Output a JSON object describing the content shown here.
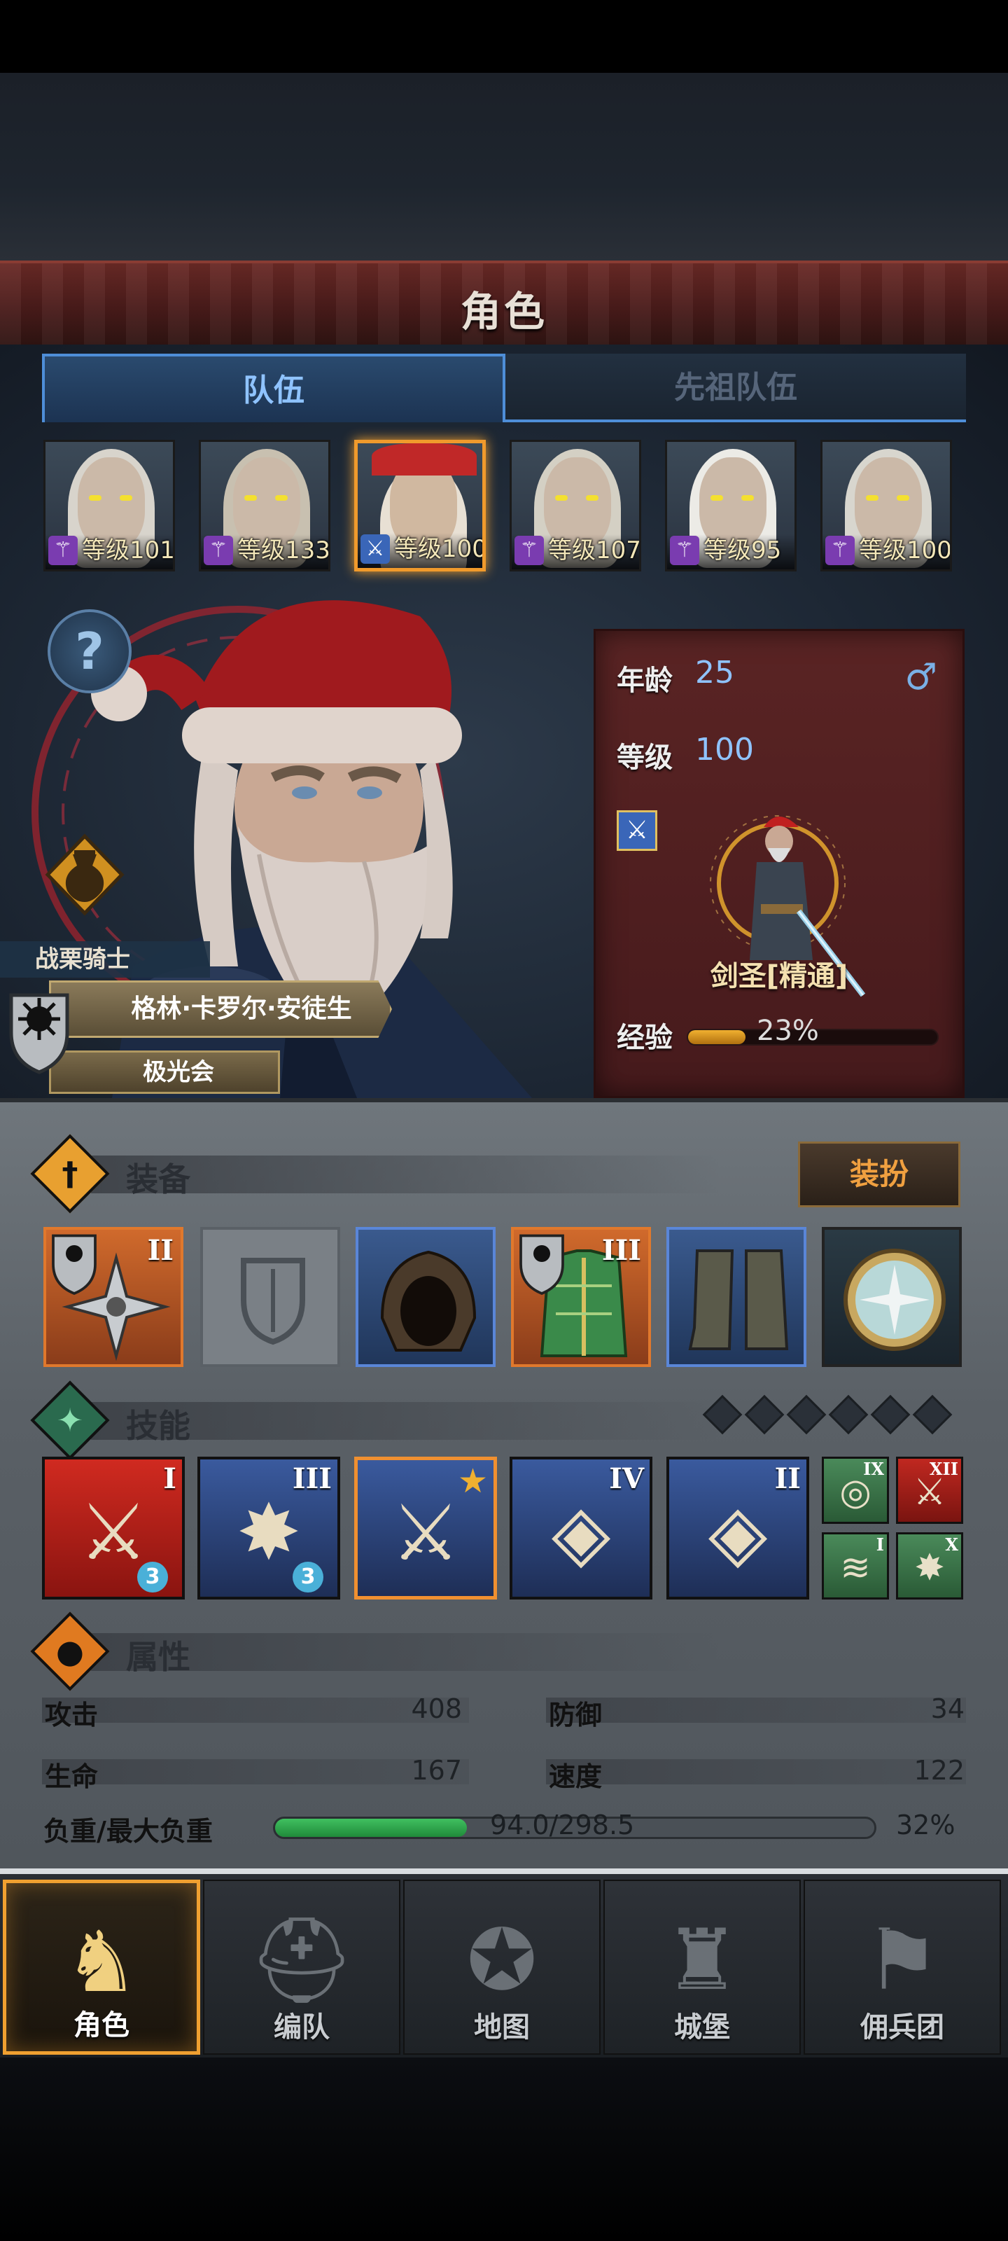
{
  "header": {
    "title": "角色"
  },
  "tabs": [
    {
      "label": "队伍",
      "active": true
    },
    {
      "label": "先祖队伍",
      "active": false
    }
  ],
  "roster": [
    {
      "level_label": "等级101",
      "class_icon": "staff-icon",
      "selected": false
    },
    {
      "level_label": "等级133",
      "class_icon": "staff-icon",
      "selected": false
    },
    {
      "level_label": "等级100",
      "class_icon": "sword-icon",
      "selected": true
    },
    {
      "level_label": "等级107",
      "class_icon": "staff-icon",
      "selected": false
    },
    {
      "level_label": "等级95",
      "class_icon": "staff-icon",
      "selected": false
    },
    {
      "level_label": "等级100",
      "class_icon": "staff-icon",
      "selected": false
    }
  ],
  "hero": {
    "title_tag": "战栗骑士",
    "name": "格林·卡罗尔·安徒生",
    "guild": "极光会",
    "help_icon": "?"
  },
  "stats_panel": {
    "age_label": "年龄",
    "age_value": "25",
    "level_label": "等级",
    "level_value": "100",
    "gender_icon": "♂",
    "class_name": "剑圣[精通]",
    "exp_label": "经验",
    "exp_percent_text": "23%",
    "exp_fraction": 0.23
  },
  "equipment": {
    "title": "装备",
    "dress_button": "装扮",
    "slots": [
      {
        "tier": "II",
        "rarity": "orange",
        "icon": "shuriken-icon"
      },
      {
        "tier": "",
        "rarity": "grey",
        "icon": "empty-shield-icon"
      },
      {
        "tier": "",
        "rarity": "blue",
        "icon": "hood-icon"
      },
      {
        "tier": "III",
        "rarity": "orange",
        "icon": "armor-icon"
      },
      {
        "tier": "",
        "rarity": "blue",
        "icon": "boots-icon"
      },
      {
        "tier": "",
        "rarity": "dark",
        "icon": "amulet-icon"
      }
    ]
  },
  "skills": {
    "title": "技能",
    "slots": [
      {
        "tier": "I",
        "color": "red",
        "count": "3",
        "glyph": "⚔"
      },
      {
        "tier": "III",
        "color": "blue",
        "count": "3",
        "glyph": "✸"
      },
      {
        "tier": "",
        "color": "blue",
        "count": "",
        "glyph": "⚔",
        "starred": true
      },
      {
        "tier": "IV",
        "color": "blue",
        "count": "",
        "glyph": "◈"
      },
      {
        "tier": "II",
        "color": "blue",
        "count": "",
        "glyph": "◈"
      }
    ],
    "mini": [
      {
        "tier": "IX",
        "color": "green",
        "glyph": "◎"
      },
      {
        "tier": "XII",
        "color": "red",
        "glyph": "⚔"
      },
      {
        "tier": "I",
        "color": "green",
        "glyph": "≋"
      },
      {
        "tier": "X",
        "color": "green",
        "glyph": "✸"
      }
    ]
  },
  "attributes": {
    "title": "属性",
    "attack_label": "攻击",
    "attack_value": "408",
    "defense_label": "防御",
    "defense_value": "34",
    "hp_label": "生命",
    "hp_value": "167",
    "speed_label": "速度",
    "speed_value": "122",
    "load_label": "负重/最大负重",
    "load_text": "94.0/298.5",
    "load_percent_text": "32%",
    "load_fraction": 0.32
  },
  "nav": [
    {
      "label": "角色",
      "icon": "knight-icon",
      "glyph": "♞",
      "active": true
    },
    {
      "label": "编队",
      "icon": "helmet-icon",
      "glyph": "⛑",
      "active": false
    },
    {
      "label": "地图",
      "icon": "compass-map-icon",
      "glyph": "✪",
      "active": false
    },
    {
      "label": "城堡",
      "icon": "castle-icon",
      "glyph": "♜",
      "active": false
    },
    {
      "label": "佣兵团",
      "icon": "flag-icon",
      "glyph": "⚑",
      "active": false
    }
  ],
  "colors": {
    "accent_blue": "#4e8ed8",
    "selected_orange": "#f09a2c",
    "title_red": "#4a1b1a",
    "panel_red": "#5a2424",
    "load_green": "#30b050"
  }
}
